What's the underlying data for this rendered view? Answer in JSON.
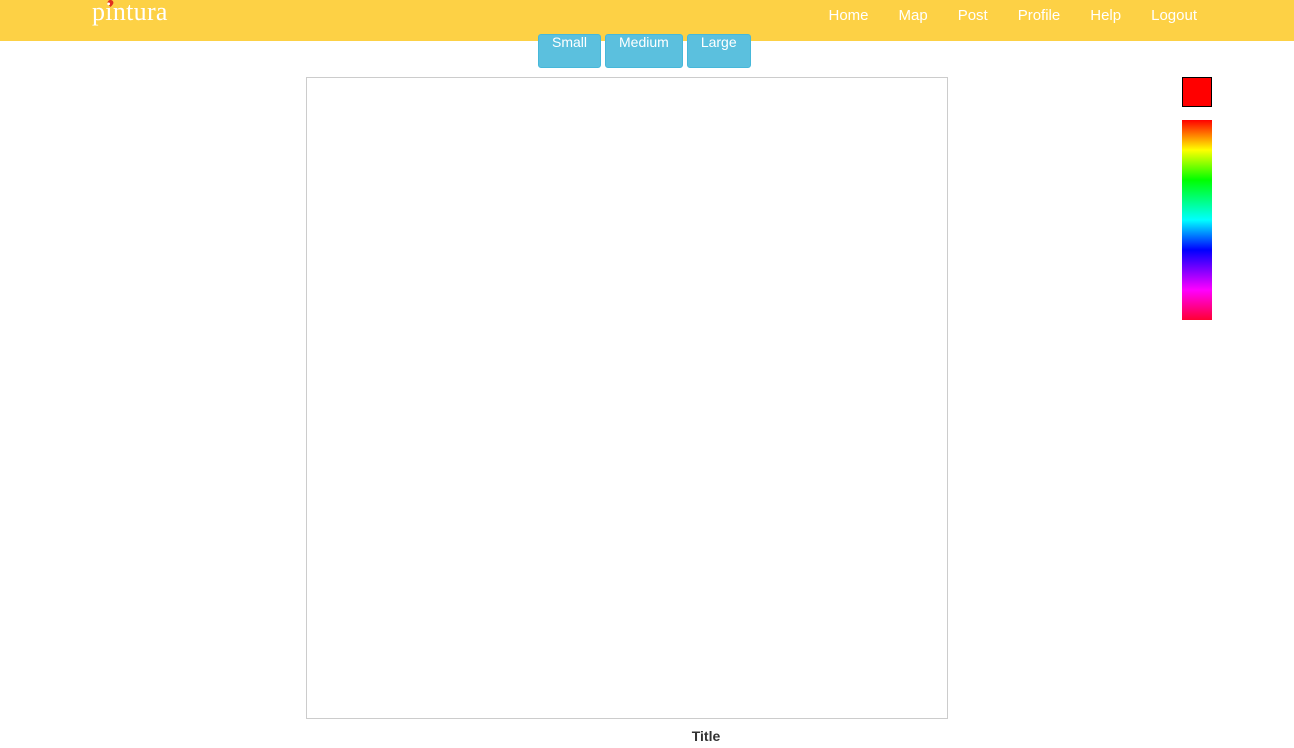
{
  "navbar": {
    "brand": "pintura",
    "brand_pin_color": "#e0301e",
    "background": "#fdd145",
    "links": [
      {
        "label": "Home"
      },
      {
        "label": "Map"
      },
      {
        "label": "Post"
      },
      {
        "label": "Profile"
      },
      {
        "label": "Help"
      },
      {
        "label": "Logout"
      }
    ]
  },
  "toolbar": {
    "size_buttons": [
      {
        "label": "Small"
      },
      {
        "label": "Medium"
      },
      {
        "label": "Large"
      }
    ],
    "button_color": "#5bc0de"
  },
  "palette": {
    "selected_color": "#ff0000"
  },
  "drawing": {
    "title_label": "Title"
  }
}
